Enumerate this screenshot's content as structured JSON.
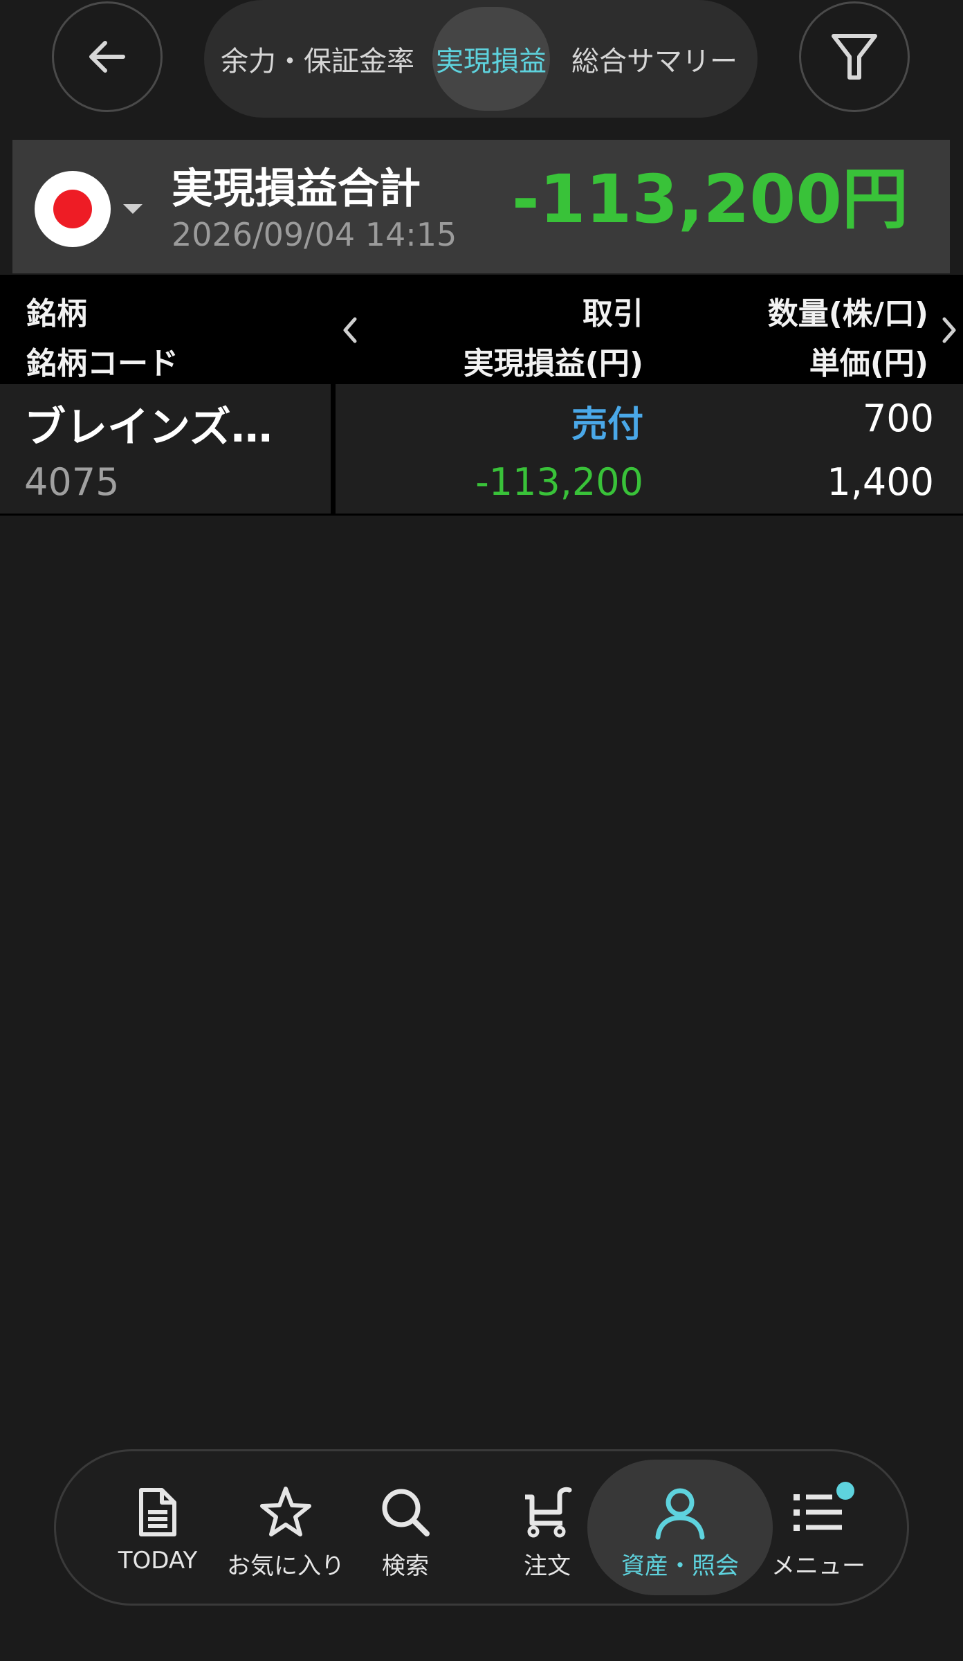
{
  "header": {
    "tabs": [
      {
        "label": "余力・保証金率",
        "active": false
      },
      {
        "label": "実現損益",
        "active": true
      },
      {
        "label": "総合サマリー",
        "active": false
      }
    ]
  },
  "summary": {
    "title": "実現損益合計",
    "timestamp": "2026/09/04 14:15",
    "total": "-113,200円",
    "market_flag": "japan-flag"
  },
  "table": {
    "headers": {
      "col1_line1": "銘柄",
      "col1_line2": "銘柄コード",
      "col2_line1": "取引",
      "col2_line2": "実現損益(円)",
      "col3_line1": "数量(株/口)",
      "col3_line2": "単価(円)"
    },
    "rows": [
      {
        "name": "ブレインズ…",
        "code": "4075",
        "trade": "売付",
        "pl": "-113,200",
        "quantity": "700",
        "price": "1,400"
      }
    ]
  },
  "bottom_nav": {
    "items": [
      {
        "label": "TODAY",
        "icon": "document-icon"
      },
      {
        "label": "お気に入り",
        "icon": "star-icon"
      },
      {
        "label": "検索",
        "icon": "search-icon"
      },
      {
        "label": "注文",
        "icon": "order-cart-icon"
      },
      {
        "label": "資産・照会",
        "icon": "person-icon",
        "active": true
      },
      {
        "label": "メニュー",
        "icon": "list-menu-icon"
      }
    ]
  },
  "colors": {
    "background": "#1b1b1b",
    "accent": "#5ed3de",
    "loss_green": "#39c239",
    "sell_blue": "#4aa8e8"
  }
}
